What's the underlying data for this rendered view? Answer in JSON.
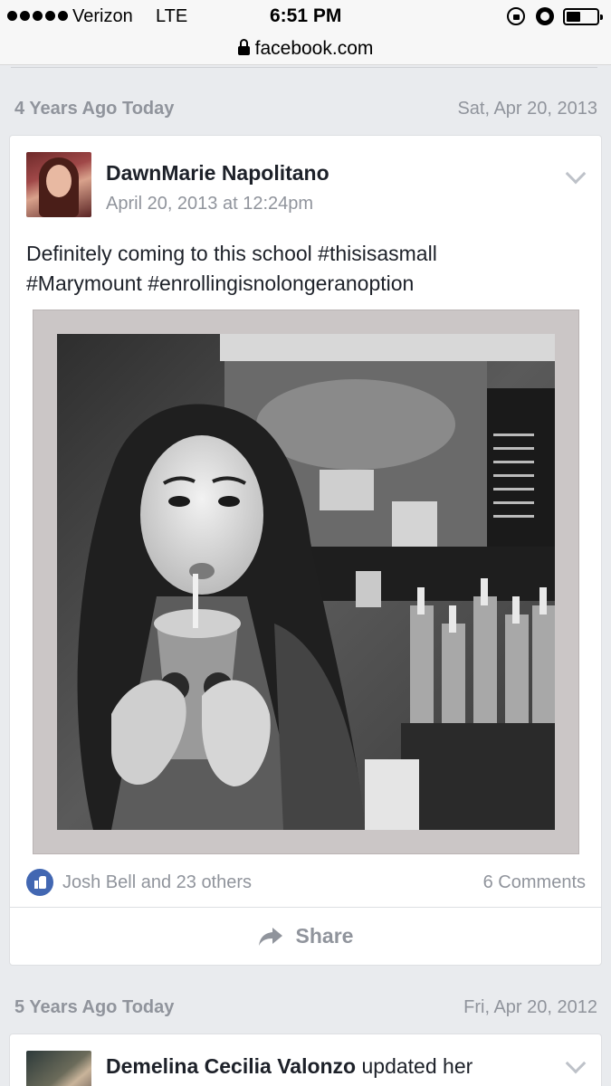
{
  "status_bar": {
    "carrier": "Verizon",
    "network": "LTE",
    "time": "6:51 PM"
  },
  "browser": {
    "url": "facebook.com"
  },
  "memories": [
    {
      "label": "4 Years Ago Today",
      "date": "Sat, Apr 20, 2013",
      "post": {
        "author": "DawnMarie Napolitano",
        "timestamp": "April 20, 2013 at 12:24pm",
        "text_line1": "Definitely coming to this school #thisisasmall",
        "text_line2": "#Marymount #enrollingisnolongeranoption",
        "likes": "Josh Bell and 23 others",
        "comments": "6 Comments",
        "share_label": "Share"
      }
    },
    {
      "label": "5 Years Ago Today",
      "date": "Fri, Apr 20, 2012",
      "post": {
        "author": "Demelina Cecilia Valonzo",
        "action": "updated her"
      }
    }
  ],
  "colors": {
    "background": "#e9ebee",
    "like_blue": "#4267b2",
    "muted_text": "#90949c"
  }
}
